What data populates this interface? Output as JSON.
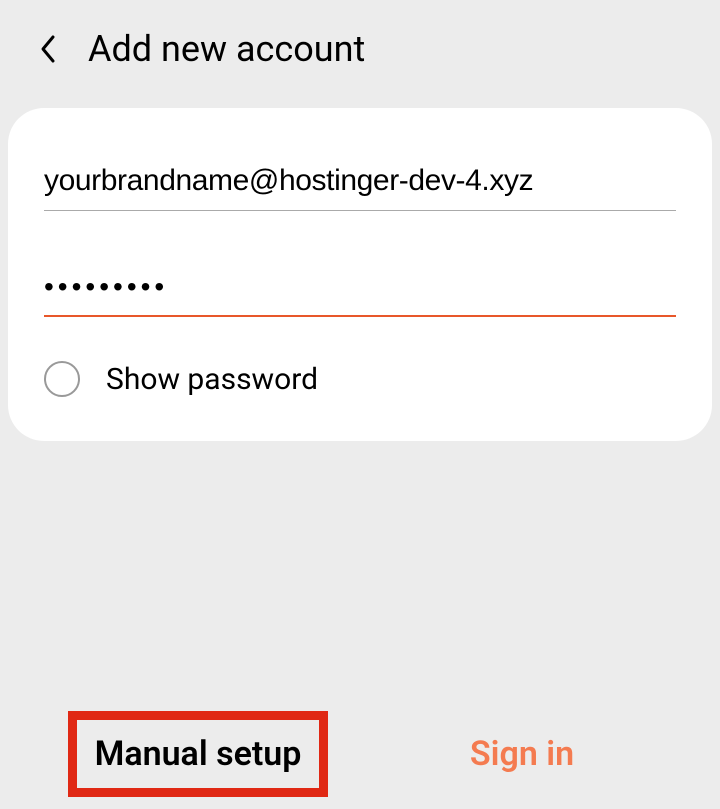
{
  "header": {
    "title": "Add new account"
  },
  "form": {
    "email_value": "yourbrandname@hostinger-dev-4.xyz",
    "password_value": "•••••••••",
    "show_password_label": "Show password"
  },
  "footer": {
    "manual_setup_label": "Manual setup",
    "signin_label": "Sign in"
  },
  "colors": {
    "accent": "#e8572a",
    "highlight_border": "#e02814",
    "signin_color": "#f47b50"
  }
}
